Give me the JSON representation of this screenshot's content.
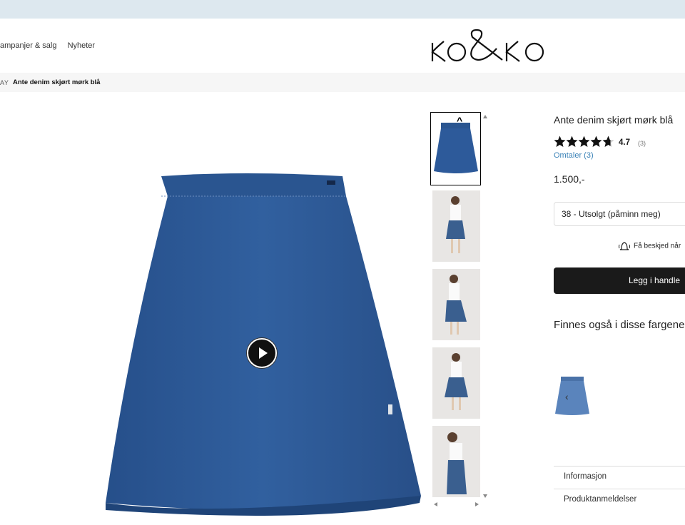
{
  "header": {
    "nav": [
      "ampanjer & salg",
      "Nyheter"
    ],
    "logo_text": "KO&KO"
  },
  "breadcrumb": {
    "prev": "AY",
    "current": "Ante denim skjørt mørk blå"
  },
  "product": {
    "title": "Ante denim skjørt mørk blå",
    "rating": "4.7",
    "rating_value": 4.7,
    "review_count": "(3)",
    "reviews_link": "Omtaler (3)",
    "price": "1.500,-",
    "size_select": "38 - Utsolgt (påminn meg)",
    "notify_text": "Få beskjed når",
    "add_to_cart": "Legg i handle",
    "colors_heading": "Finnes også i disse fargene"
  },
  "accordion": [
    "Informasjon",
    "Produktanmeldelser"
  ],
  "colors": {
    "denim": "#2d5a9a",
    "denim_dark": "#1f4478",
    "button_bg": "#1a1a1a",
    "link": "#3a82b7",
    "topbar": "#dde8ef"
  },
  "icons": {
    "play": "play-icon",
    "bell": "bell-icon",
    "chevron_up": "chevron-up-icon",
    "chevron_left": "chevron-left-icon"
  }
}
